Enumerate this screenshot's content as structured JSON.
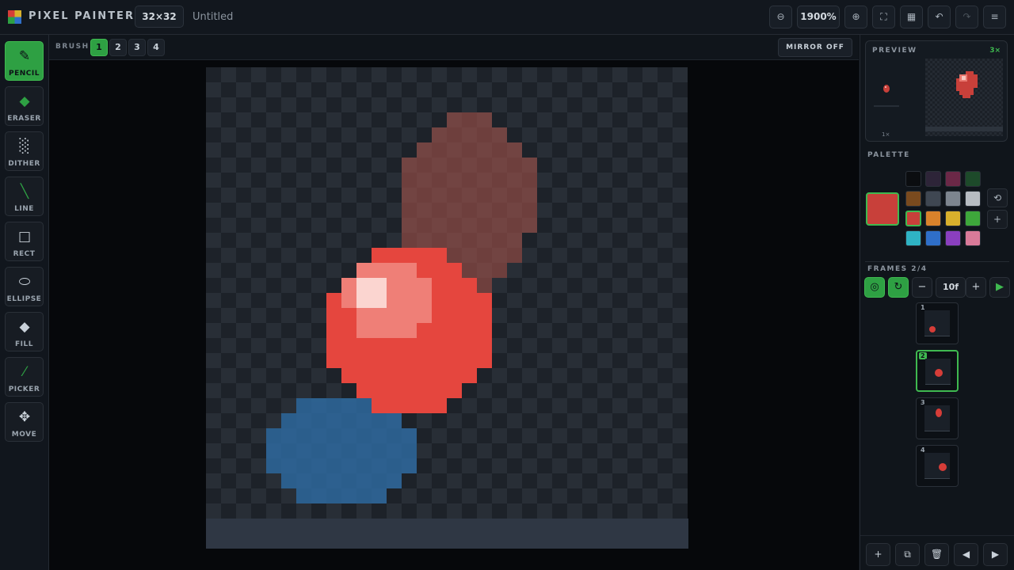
{
  "app": {
    "title": "PIXEL PAINTER",
    "canvas_size": "32×32",
    "document_name": "Untitled"
  },
  "header_actions": {
    "zoom_out_icon": "zoom-out-icon",
    "zoom": "1900%",
    "zoom_in_icon": "zoom-in-icon",
    "icons": [
      "fit-screen-icon",
      "grid-icon",
      "undo-icon",
      "redo-icon",
      "menu-icon"
    ]
  },
  "tools": [
    {
      "label": "PENCIL",
      "icon": "pencil-icon",
      "active": true
    },
    {
      "label": "ERASER",
      "icon": "eraser-icon"
    },
    {
      "label": "DITHER",
      "icon": "dither-icon"
    },
    {
      "label": "LINE",
      "icon": "line-icon"
    },
    {
      "label": "RECT",
      "icon": "rect-icon"
    },
    {
      "label": "ELLIPSE",
      "icon": "ellipse-icon"
    },
    {
      "label": "FILL",
      "icon": "fill-icon"
    },
    {
      "label": "PICKER",
      "icon": "picker-icon"
    },
    {
      "label": "MOVE",
      "icon": "move-icon"
    }
  ],
  "brush": {
    "label": "BRUSH",
    "sizes": [
      "1",
      "2",
      "3",
      "4"
    ],
    "active": "1"
  },
  "mirror": {
    "label": "MIRROR OFF"
  },
  "preview": {
    "label": "PREVIEW",
    "scale": "3×",
    "small_scale": "1×"
  },
  "palette": {
    "label": "PALETTE",
    "current": "#c8403a",
    "swatches": [
      "#0b0d10",
      "#2d2438",
      "#6b2847",
      "#1d4a2a",
      "#7a4a1e",
      "#3f4752",
      "#7d858f",
      "#b7bcc2",
      "#c8403a",
      "#d9822b",
      "#d8b02c",
      "#3ea73b",
      "#2fb3c4",
      "#2f6fc9",
      "#8a3fbf",
      "#d97a99"
    ],
    "selected_index": 8
  },
  "frames": {
    "label": "FRAMES 2/4",
    "fps": "10f",
    "active": 2,
    "numbers": [
      "1",
      "2",
      "3",
      "4"
    ]
  },
  "colors": {
    "accent": "#2ea043",
    "onion_red": "#a0524a",
    "ball_red": "#e5463e",
    "ball_blue": "#2f6fa8"
  }
}
